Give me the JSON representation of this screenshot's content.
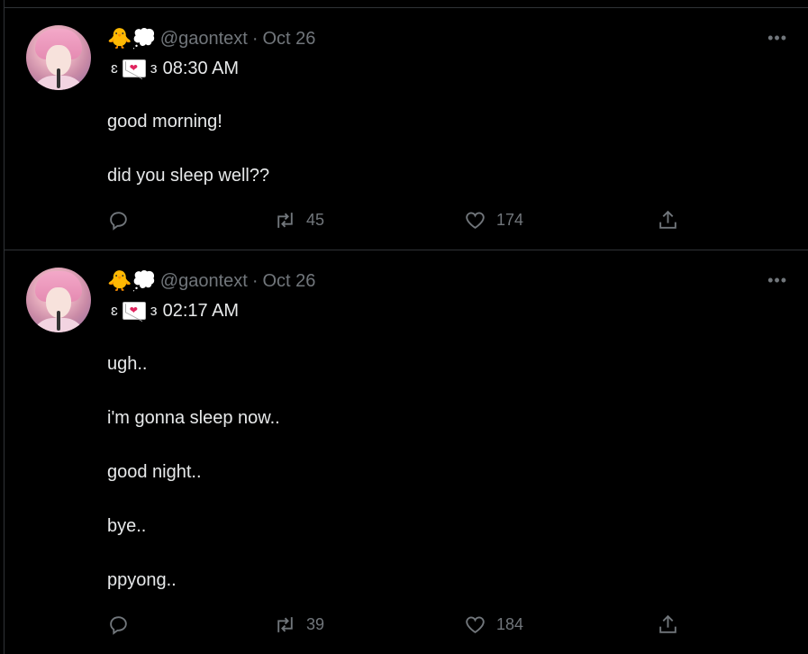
{
  "tweets": [
    {
      "emoji": "🐥💭",
      "handle": "@gaontext",
      "separator": "·",
      "date": "Oct 26",
      "bracket_left": "ɛ",
      "bracket_right": "з",
      "time": "08:30 AM",
      "lines": [
        "good morning!",
        "did you sleep well??"
      ],
      "retweets": "45",
      "likes": "174"
    },
    {
      "emoji": "🐥💭",
      "handle": "@gaontext",
      "separator": "·",
      "date": "Oct 26",
      "bracket_left": "ɛ",
      "bracket_right": "з",
      "time": "02:17 AM",
      "lines": [
        "ugh..",
        "i'm gonna sleep now..",
        "good night..",
        "bye..",
        "ppyong.."
      ],
      "retweets": "39",
      "likes": "184"
    }
  ],
  "icons": {
    "more": "more-icon",
    "reply": "reply-icon",
    "retweet": "retweet-icon",
    "like": "heart-icon",
    "share": "share-icon"
  },
  "colors": {
    "background": "#000000",
    "text": "#e7e9ea",
    "muted": "#71767b",
    "border": "#2f3336"
  }
}
